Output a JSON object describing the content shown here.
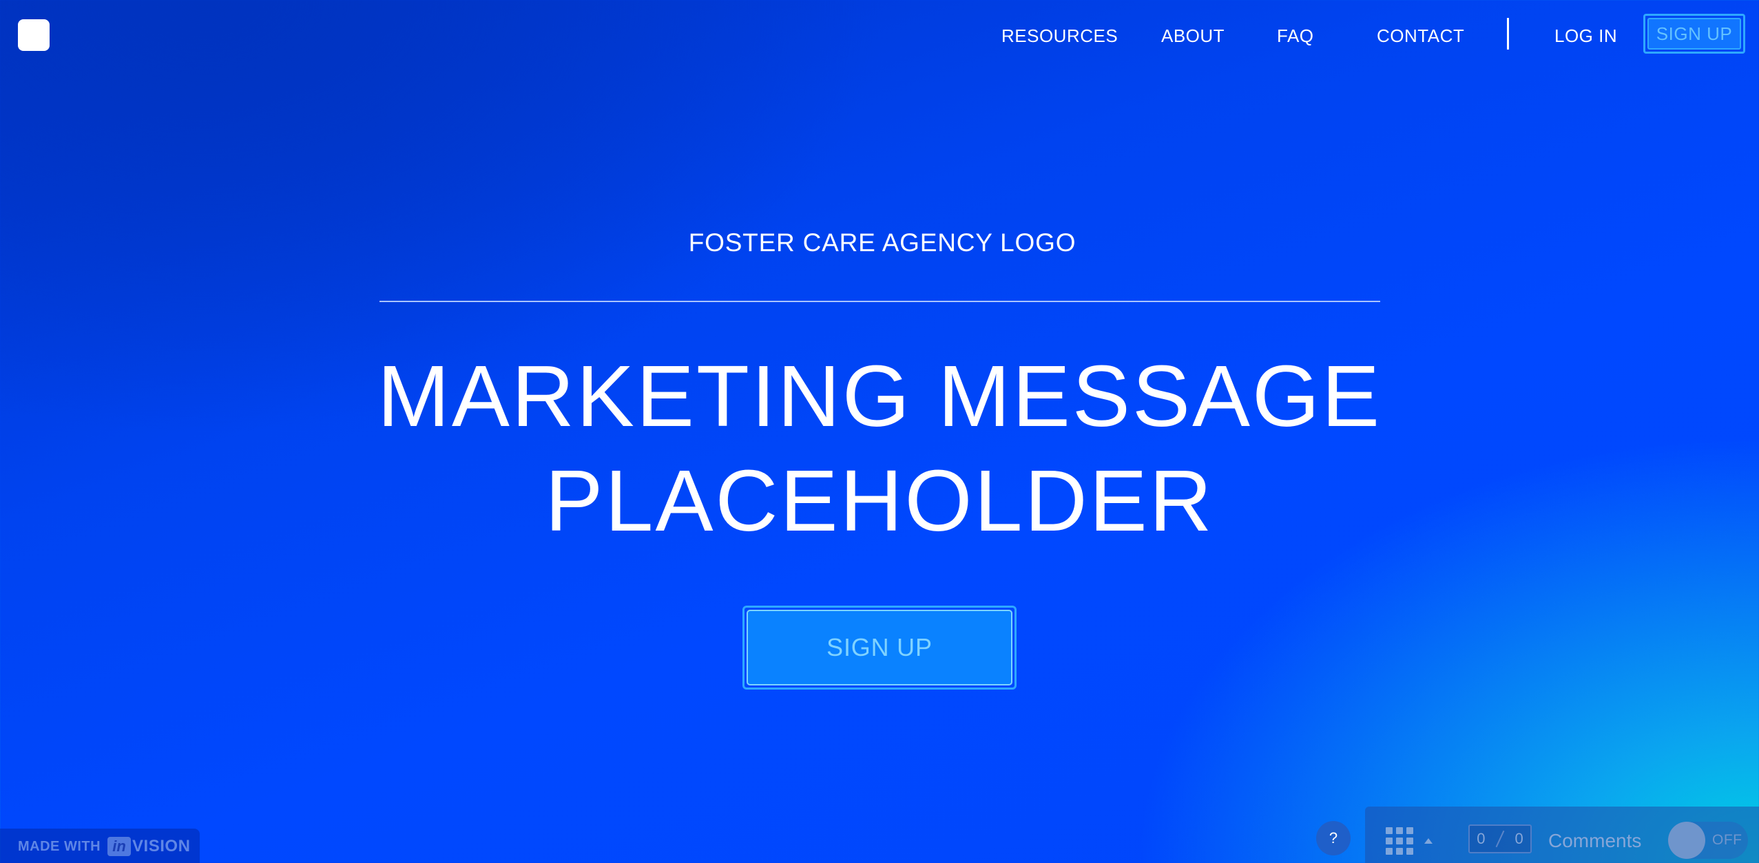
{
  "nav": {
    "items": [
      {
        "label": "RESOURCES"
      },
      {
        "label": "ABOUT"
      },
      {
        "label": "FAQ"
      },
      {
        "label": "CONTACT"
      }
    ],
    "login_label": "LOG IN",
    "signup_label": "SIGN UP"
  },
  "hero": {
    "logo_text": "FOSTER CARE AGENCY LOGO",
    "headline_line1": "MARKETING MESSAGE",
    "headline_line2": "PLACEHOLDER",
    "cta_label": "SIGN UP"
  },
  "badge": {
    "made_with": "MADE WITH",
    "brand_in": "in",
    "brand_rest": "VISION"
  },
  "toolbar": {
    "help_label": "?",
    "counter_left": "0",
    "counter_right": "0",
    "comments_label": "Comments",
    "toggle_label": "OFF",
    "toggle_state": "off"
  },
  "colors": {
    "background": "#0048ff",
    "accent": "#2ea8ff",
    "text": "#ffffff"
  },
  "icons": [
    "logo-square",
    "grid-icon",
    "caret-up-icon",
    "help-icon"
  ]
}
